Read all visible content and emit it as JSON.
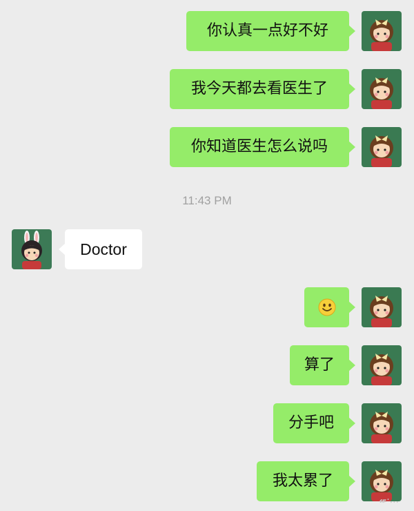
{
  "chat": {
    "messages": [
      {
        "side": "right",
        "text": "你认真一点好不好"
      },
      {
        "side": "right",
        "text": "我今天都去看医生了"
      },
      {
        "side": "right",
        "text": "你知道医生怎么说吗"
      },
      {
        "side": "left",
        "text": "Doctor"
      },
      {
        "side": "right",
        "text": "",
        "emoji": "smiling-face-emoji"
      },
      {
        "side": "right",
        "text": "算了"
      },
      {
        "side": "right",
        "text": "分手吧"
      },
      {
        "side": "right",
        "text": "我太累了"
      }
    ],
    "timestamp": "11:43 PM"
  },
  "colors": {
    "background": "#ececec",
    "outgoing_bubble": "#95ec69",
    "incoming_bubble": "#ffffff",
    "timestamp_text": "#a0a0a0",
    "self_avatar_bg": "#3a7a52",
    "contact_avatar_bg": "#3c7a56"
  },
  "watermark": "𝔀·..."
}
